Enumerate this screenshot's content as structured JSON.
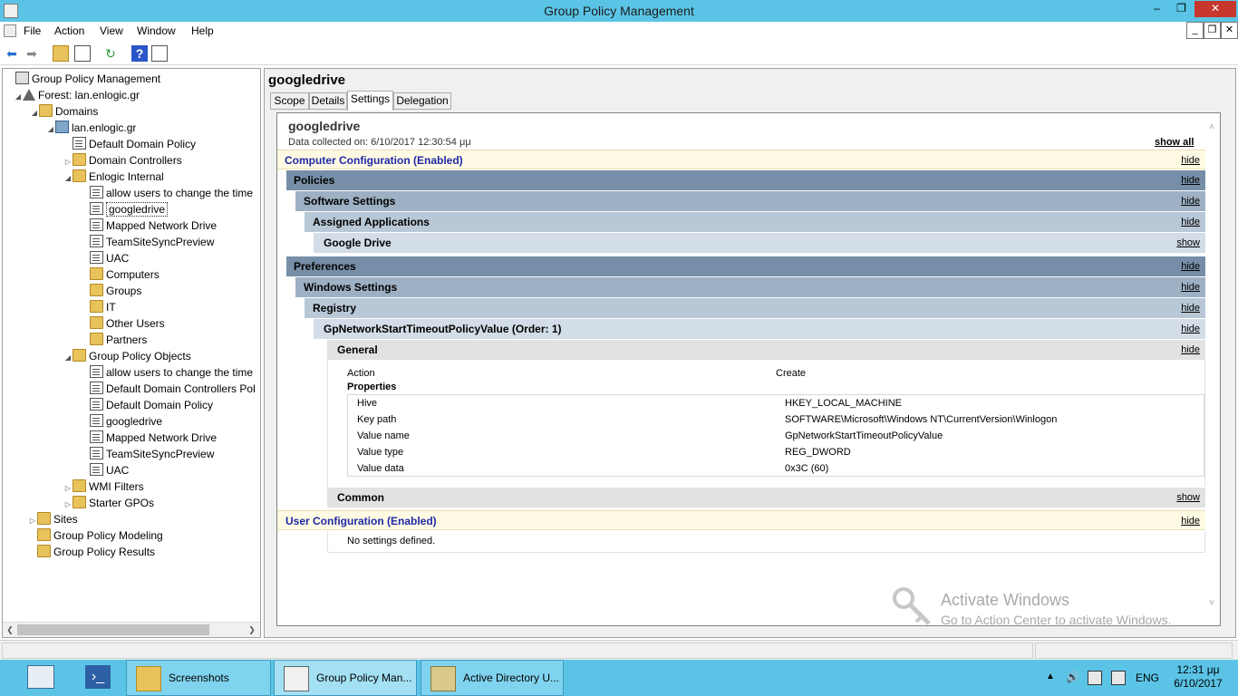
{
  "window": {
    "title": "Group Policy Management",
    "min": "–",
    "max": "❐",
    "close": "✕"
  },
  "menu": [
    "File",
    "Action",
    "View",
    "Window",
    "Help"
  ],
  "mdi": {
    "min": "_",
    "restore": "❐",
    "close": "✕"
  },
  "toolbar": {
    "back": "⬅",
    "forward": "➡",
    "help": "?"
  },
  "tree": [
    {
      "label": "Group Policy Management",
      "icon": "gpm-icon"
    },
    {
      "label": "Forest: lan.enlogic.gr",
      "icon": "forest-icon"
    },
    {
      "label": "Domains",
      "icon": "folder-icon"
    },
    {
      "label": "lan.enlogic.gr",
      "icon": "domain-icon"
    },
    {
      "label": "Default Domain Policy",
      "icon": "gpo-icon"
    },
    {
      "label": "Domain Controllers",
      "icon": "folder-icon"
    },
    {
      "label": "Enlogic Internal",
      "icon": "folder-icon"
    },
    {
      "label": "allow users to change the time",
      "icon": "gpo-icon"
    },
    {
      "label": "googledrive",
      "icon": "gpo-icon"
    },
    {
      "label": "Mapped Network Drive",
      "icon": "gpo-icon"
    },
    {
      "label": "TeamSiteSyncPreview",
      "icon": "gpo-icon"
    },
    {
      "label": "UAC",
      "icon": "gpo-icon"
    },
    {
      "label": "Computers",
      "icon": "folder-icon"
    },
    {
      "label": "Groups",
      "icon": "folder-icon"
    },
    {
      "label": "IT",
      "icon": "folder-icon"
    },
    {
      "label": "Other Users",
      "icon": "folder-icon"
    },
    {
      "label": "Partners",
      "icon": "folder-icon"
    },
    {
      "label": "Group Policy Objects",
      "icon": "folder-icon"
    },
    {
      "label": "allow users to change the time",
      "icon": "gpo-icon"
    },
    {
      "label": "Default Domain Controllers Pol",
      "icon": "gpo-icon"
    },
    {
      "label": "Default Domain Policy",
      "icon": "gpo-icon"
    },
    {
      "label": "googledrive",
      "icon": "gpo-icon"
    },
    {
      "label": "Mapped Network Drive",
      "icon": "gpo-icon"
    },
    {
      "label": "TeamSiteSyncPreview",
      "icon": "gpo-icon"
    },
    {
      "label": "UAC",
      "icon": "gpo-icon"
    },
    {
      "label": "WMI Filters",
      "icon": "folder-icon"
    },
    {
      "label": "Starter GPOs",
      "icon": "folder-icon"
    },
    {
      "label": "Sites",
      "icon": "folder-icon"
    },
    {
      "label": "Group Policy Modeling",
      "icon": "folder-icon"
    },
    {
      "label": "Group Policy Results",
      "icon": "folder-icon"
    }
  ],
  "right": {
    "title": "googledrive",
    "tabs": [
      "Scope",
      "Details",
      "Settings",
      "Delegation"
    ],
    "active_tab": "Settings"
  },
  "report": {
    "name": "googledrive",
    "collected": "Data collected on: 6/10/2017 12:30:54 μμ",
    "show_all": "show all",
    "hide": "hide",
    "show": "show",
    "computer_config": "Computer Configuration (Enabled)",
    "policies": "Policies",
    "software_settings": "Software Settings",
    "assigned_applications": "Assigned Applications",
    "google_drive": "Google Drive",
    "preferences": "Preferences",
    "windows_settings": "Windows Settings",
    "registry": "Registry",
    "registry_item": "GpNetworkStartTimeoutPolicyValue (Order: 1)",
    "general": "General",
    "action_label": "Action",
    "action_value": "Create",
    "properties": "Properties",
    "props": [
      {
        "key": "Hive",
        "value": "HKEY_LOCAL_MACHINE"
      },
      {
        "key": "Key path",
        "value": "SOFTWARE\\Microsoft\\Windows NT\\CurrentVersion\\Winlogon"
      },
      {
        "key": "Value name",
        "value": "GpNetworkStartTimeoutPolicyValue"
      },
      {
        "key": "Value type",
        "value": "REG_DWORD"
      },
      {
        "key": "Value data",
        "value": "0x3C (60)"
      }
    ],
    "common": "Common",
    "user_config": "User Configuration (Enabled)",
    "no_settings": "No settings defined."
  },
  "watermark": {
    "line1": "Activate Windows",
    "line2": "Go to Action Center to activate Windows."
  },
  "taskbar": {
    "items": [
      "Screenshots",
      "Group Policy Man...",
      "Active Directory U..."
    ],
    "lang": "ENG",
    "time": "12:31 μμ",
    "date": "6/10/2017"
  }
}
